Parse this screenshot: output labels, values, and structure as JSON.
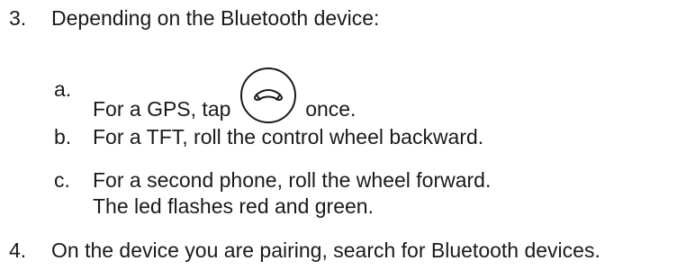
{
  "steps": [
    {
      "number": "3.",
      "text": "Depending on the Bluetooth device:"
    },
    {
      "number": "4.",
      "text": "On the device you are pairing, search for Bluetooth devices."
    }
  ],
  "substeps": [
    {
      "letter": "a.",
      "text_before": "For a GPS, tap",
      "icon": "phone-handset-button-icon",
      "text_after": "once."
    },
    {
      "letter": "b.",
      "text": "For a TFT, roll the control wheel backward."
    },
    {
      "letter": "c.",
      "text": "For a second phone, roll the wheel forward.",
      "note": "The led flashes red and green."
    }
  ]
}
